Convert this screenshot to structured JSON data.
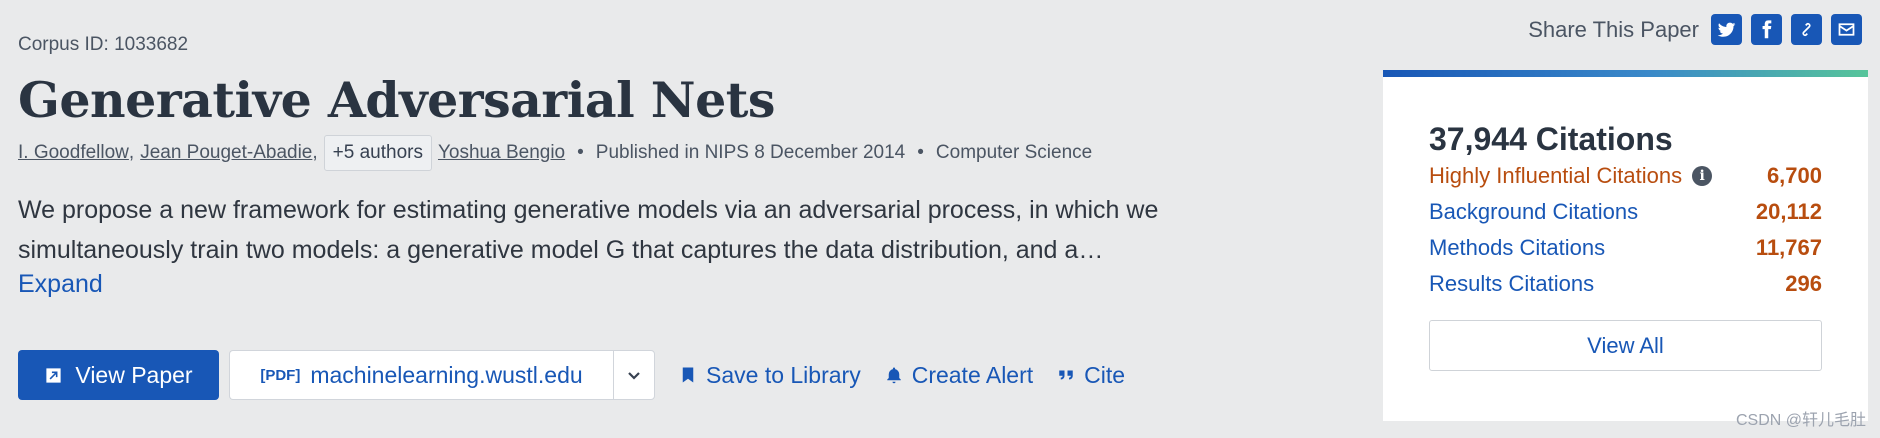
{
  "share": {
    "label": "Share This Paper",
    "buttons": [
      "twitter-icon",
      "facebook-icon",
      "link-icon",
      "email-icon"
    ]
  },
  "paper": {
    "corpus_id": "Corpus ID: 1033682",
    "title": "Generative Adversarial Nets",
    "authors": [
      "I. Goodfellow",
      "Jean Pouget-Abadie"
    ],
    "more_authors": "+5 authors",
    "last_author": "Yoshua Bengio",
    "published": "Published in NIPS 8 December 2014",
    "field": "Computer Science",
    "abstract": "We propose a new framework for estimating generative models via an adversarial process, in which we simultaneously train two models: a generative model G that captures the data distribution, and a…",
    "expand": "Expand"
  },
  "actions": {
    "view_paper": "View Paper",
    "pdf_tag": "[PDF]",
    "source": "machinelearning.wustl.edu",
    "save": "Save to Library",
    "alert": "Create Alert",
    "cite": "Cite"
  },
  "citations": {
    "total": "37,944 Citations",
    "rows": [
      {
        "label": "Highly Influential Citations",
        "count": "6,700"
      },
      {
        "label": "Background Citations",
        "count": "20,112"
      },
      {
        "label": "Methods Citations",
        "count": "11,767"
      },
      {
        "label": "Results Citations",
        "count": "296"
      }
    ],
    "view_all": "View All"
  },
  "watermark": "CSDN @轩儿毛肚",
  "colors": {
    "accent": "#1857b6",
    "citation_count": "#b84d0f",
    "background": "#e9eaeb"
  }
}
